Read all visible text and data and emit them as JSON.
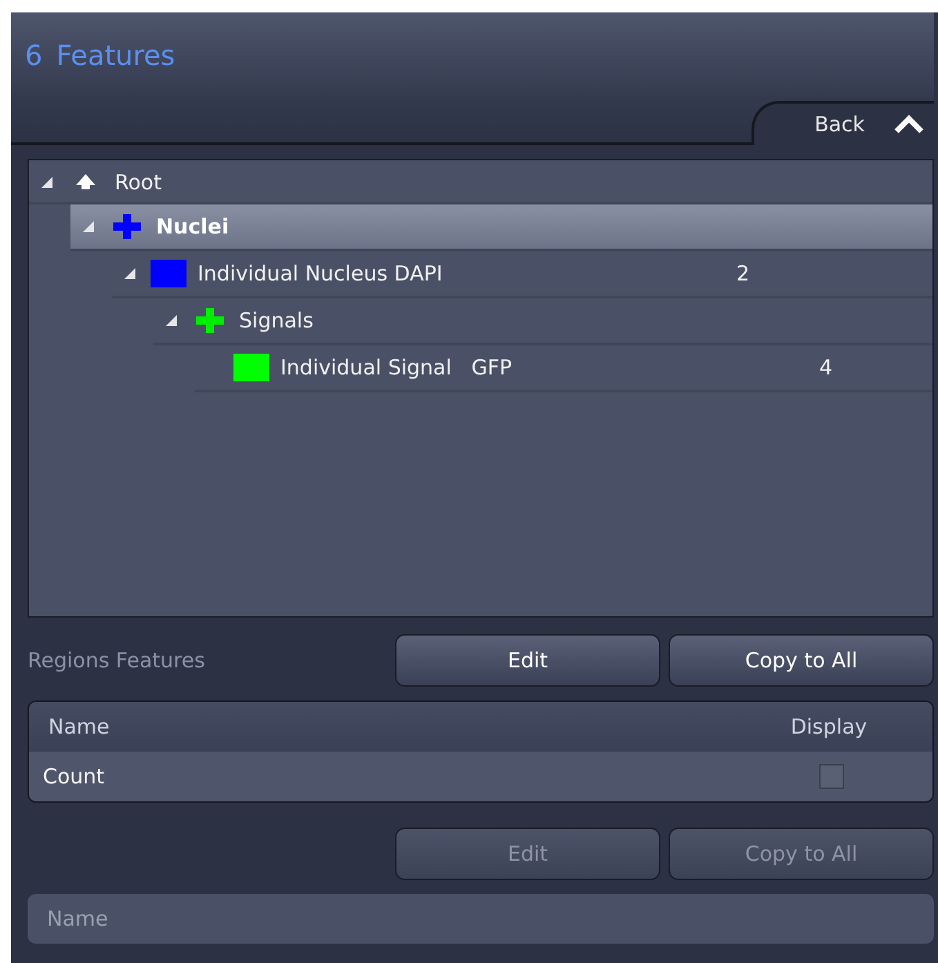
{
  "panel": {
    "number": "6",
    "title": "Features",
    "back_label": "Back",
    "collapse_expanded": true
  },
  "tree": [
    {
      "kind": "root",
      "label": "Root",
      "expanded": true,
      "selected": false,
      "children": [
        {
          "kind": "group",
          "label": "Nuclei",
          "color": "#0000ff",
          "expanded": true,
          "selected": true,
          "children": [
            {
              "kind": "class",
              "label": "Individual Nucleus DAPI",
              "color": "#0000ff",
              "count": "2",
              "expanded": true,
              "selected": false,
              "children": [
                {
                  "kind": "group",
                  "label": "Signals",
                  "color": "#00ee00",
                  "expanded": true,
                  "selected": false,
                  "children": [
                    {
                      "kind": "class",
                      "label": "Individual Signal   GFP",
                      "color": "#00ff00",
                      "count": "4",
                      "selected": false
                    }
                  ]
                }
              ]
            }
          ]
        }
      ]
    }
  ],
  "regions": {
    "label": "Regions Features",
    "buttons": [
      {
        "label": "Edit",
        "disabled": false
      },
      {
        "label": "Copy to All",
        "disabled": false
      }
    ],
    "table": {
      "columns": [
        "Name",
        "Display"
      ],
      "rows": [
        {
          "name": "Count",
          "checked": false
        }
      ]
    }
  },
  "lower": {
    "buttons": [
      {
        "label": "Edit",
        "disabled": true
      },
      {
        "label": "Copy to All",
        "disabled": true
      }
    ],
    "table": {
      "columns": [
        "Name"
      ]
    }
  }
}
